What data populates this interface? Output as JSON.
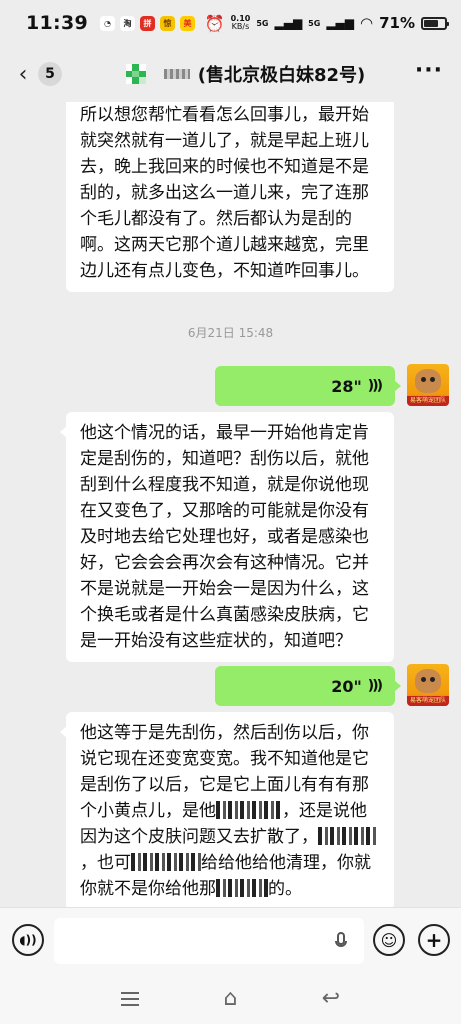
{
  "status_bar": {
    "time": "11:39",
    "app_icons": [
      {
        "name": "clock-app-icon",
        "bg": "#ffffff",
        "fg": "#333333",
        "glyph": "◔"
      },
      {
        "name": "taobao-app-icon",
        "bg": "#ffffff",
        "fg": "#222222",
        "glyph": "淘"
      },
      {
        "name": "pinduoduo-app-icon",
        "bg": "#e02e24",
        "fg": "#ffffff",
        "glyph": "拼"
      },
      {
        "name": "shopping-app-icon",
        "bg": "#f5c400",
        "fg": "#7a3b00",
        "glyph": "惊"
      },
      {
        "name": "meituan-app-icon",
        "bg": "#ffcc00",
        "fg": "#e02e24",
        "glyph": "美"
      }
    ],
    "net_speed_value": "0.10",
    "net_speed_unit": "KB/s",
    "signal_1": "5G",
    "signal_2": "5G",
    "battery": "71%",
    "battery_level": 0.71
  },
  "header": {
    "back_label": "5",
    "title": "(售北京极白妹82号)"
  },
  "messages": [
    {
      "id": "msg_text_1",
      "text": "所以想您帮忙看看怎么回事儿，最开始就突然就有一道儿了，就是早起上班儿去，晚上我回来的时候也不知道是不是刮的，就多出这么一道儿来，完了连那个毛儿都没有了。然后都认为是刮的啊。这两天它那个道儿越来越宽，完里边儿还有点儿变色，不知道咋回事儿。"
    },
    {
      "id": "timestamp",
      "text": "6月21日 15:48"
    },
    {
      "id": "voice_1",
      "duration": "28\""
    },
    {
      "id": "msg_text_2",
      "text": "他这个情况的话，最早一开始他肯定肯定是刮伤的，知道吧？刮伤以后，就他刮到什么程度我不知道，就是你说他现在又变色了，又那啥的可能就是你没有及时地去给它处理也好，或者是感染也好，它会会会再次会有这种情况。它并不是说就是一开始会一是因为什么，这个换毛或者是什么真菌感染皮肤病，它是一开始没有这些症状的，知道吧？"
    },
    {
      "id": "voice_2",
      "duration": "20\""
    },
    {
      "id": "msg_text_3",
      "text_a": "他这等于是先刮伤，然后刮伤以后，你说它现在还变宽变宽。我不知道他是它是刮伤了以后，它是它上面儿有有有那个小黄点儿，是他",
      "text_b": "，还是说他因为这个皮肤问题又去扩散了，",
      "text_c": "，也可",
      "text_d": "给给他给他清理，你就你就不是你给他那",
      "text_e": "的。"
    }
  ],
  "avatar_banner": "易客萌宠团队",
  "input": {
    "placeholder": ""
  }
}
